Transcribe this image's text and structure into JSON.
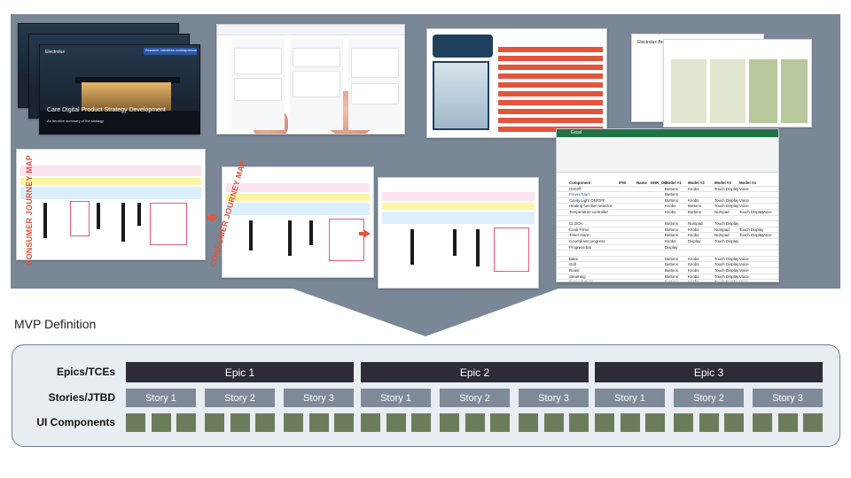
{
  "colors": {
    "funnel_gray": "#7a8797",
    "epic_fill": "#2d2b35",
    "story_fill": "#7f8a99",
    "component_fill": "#6c7d5c",
    "journey_accent": "#e2553b",
    "box_border": "#6e8196",
    "box_fill": "#e8edf2"
  },
  "collage": {
    "strategy_deck": {
      "brand": "Electrolux",
      "tag": "Research, interviews, working document",
      "headline": "Care Digital Product Strategy Development",
      "subtitle": "An iterative summary of the strategy"
    },
    "journey_maps": [
      {
        "label": "CONSUMER JOURNEY MAP"
      },
      {
        "label": "CONSUMER JOURNEY MAP"
      }
    ],
    "brand_dimensions": {
      "title": "Electrolux Brand Design Dimensions"
    },
    "spreadsheet": {
      "app_name": "Excel",
      "header_columns": [
        "Component",
        "IFW",
        "Name",
        "EHR_OC",
        "Model #1",
        "Model #2",
        "Model #3",
        "Model #4"
      ],
      "rows": [
        [
          "On/Off",
          "Buttons",
          "Knobs",
          "Touch Display",
          "Voice"
        ],
        [
          "Power/Start",
          "Buttons"
        ],
        [
          "Cavity Light ON/OFF",
          "Buttons",
          "Knobs",
          "Touch Display",
          "Voice"
        ],
        [
          "Heating function selector",
          "Knobs",
          "Buttons",
          "Touch Display",
          "Voice"
        ],
        [
          "Temperature controller",
          "Knobs",
          "Buttons",
          "Numpad",
          "Touch Display",
          "Voice"
        ],
        [
          ""
        ],
        [
          "CLOCK",
          "Buttons",
          "Numpad",
          "Touch Display"
        ],
        [
          "Cook Timer",
          "Buttons",
          "Knobs",
          "Numpad",
          "Touch Display"
        ],
        [
          "Timer Alarm",
          "Buttons",
          "Knobs",
          "Numpad",
          "Touch Display",
          "Voice"
        ],
        [
          "Countdown progress",
          "Knobs",
          "Display",
          "Touch Display"
        ],
        [
          "Progress bar",
          "Display"
        ],
        [
          ""
        ],
        [
          "Bake",
          "Buttons",
          "Knobs",
          "Touch Display",
          "Voice"
        ],
        [
          "Grill",
          "Buttons",
          "Knobs",
          "Touch Display",
          "Voice"
        ],
        [
          "Roast",
          "Buttons",
          "Knobs",
          "Touch Display",
          "Voice"
        ],
        [
          "Steaming",
          "Buttons",
          "Knobs",
          "Touch Display",
          "Voice"
        ],
        [
          "Convect Bake",
          "Buttons",
          "Knobs",
          "Touch Display",
          "Voice"
        ]
      ]
    }
  },
  "mvp": {
    "title": "MVP Definition",
    "rows": {
      "epics": "Epics/TCEs",
      "stories": "Stories/JTBD",
      "components": "UI Components"
    },
    "epics": [
      {
        "label": "Epic 1",
        "stories": [
          "Story 1",
          "Story 2",
          "Story 3"
        ]
      },
      {
        "label": "Epic 2",
        "stories": [
          "Story 1",
          "Story 2",
          "Story 3"
        ]
      },
      {
        "label": "Epic 3",
        "stories": [
          "Story 1",
          "Story 2",
          "Story 3"
        ]
      }
    ],
    "components_per_story": 3
  }
}
